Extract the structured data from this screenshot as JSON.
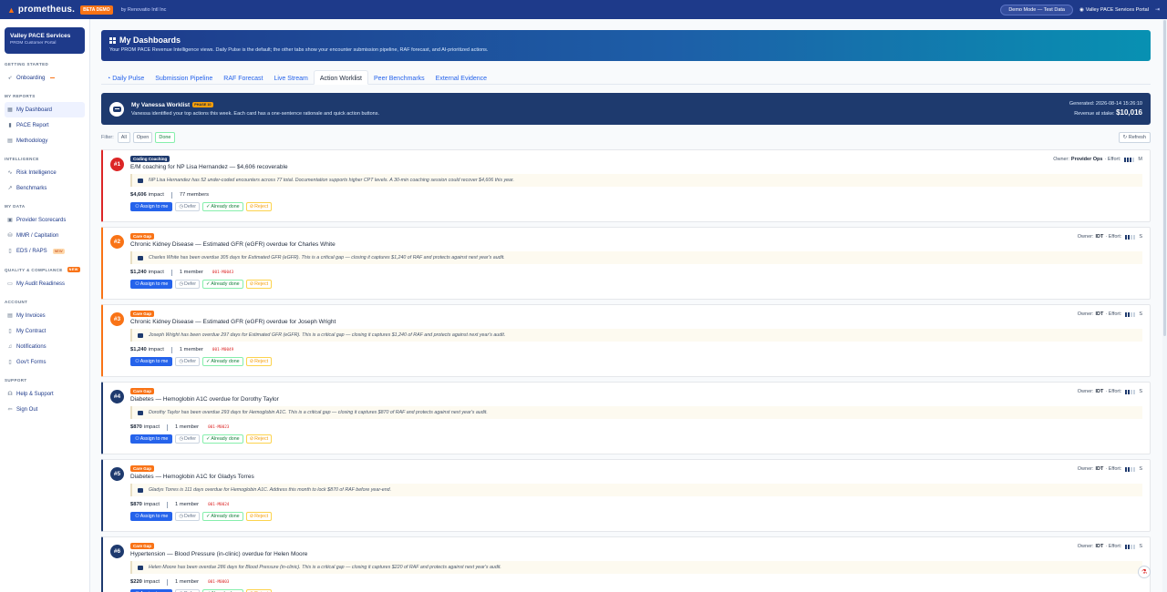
{
  "topbar": {
    "brand": "prometheus.",
    "beta": "BETA DEMO",
    "byline": "by Renovatio Intl Inc",
    "demo_mode": "Demo Mode — Test Data",
    "portal": "Valley PACE Services Portal"
  },
  "sidebar": {
    "org_name": "Valley PACE Services",
    "org_sub": "PROM Customer Portal",
    "sections": {
      "getting_started": "GETTING STARTED",
      "my_reports": "MY REPORTS",
      "intelligence": "INTELLIGENCE",
      "my_data": "MY DATA",
      "quality": "QUALITY & COMPLIANCE",
      "quality_badge": "NEW",
      "account": "ACCOUNT",
      "support": "SUPPORT"
    },
    "items": {
      "onboarding": "Onboarding",
      "my_dashboard": "My Dashboard",
      "pace_report": "PACE Report",
      "methodology": "Methodology",
      "risk_intelligence": "Risk Intelligence",
      "benchmarks": "Benchmarks",
      "provider_scorecards": "Provider Scorecards",
      "mmr_capitation": "MMR / Capitation",
      "eds_raps": "EDS / RAPS",
      "eds_badge": "NEW",
      "audit_readiness": "My Audit Readiness",
      "invoices": "My Invoices",
      "contract": "My Contract",
      "notifications": "Notifications",
      "gov_forms": "Gov't Forms",
      "help": "Help & Support",
      "sign_out": "Sign Out"
    }
  },
  "hero": {
    "title": "My Dashboards",
    "desc": "Your PROM PACE Revenue Intelligence views. Daily Pulse is the default; the other tabs show your encounter submission pipeline, RAF forecast, and AI-prioritized actions."
  },
  "tabs": [
    "Daily Pulse",
    "Submission Pipeline",
    "RAF Forecast",
    "Live Stream",
    "Action Worklist",
    "Peer Benchmarks",
    "External Evidence"
  ],
  "worklist": {
    "title": "My Vanessa Worklist",
    "phase": "PHASE 10",
    "desc": "Vanessa identified your top actions this week. Each card has a one-sentence rationale and quick action buttons.",
    "generated": "Generated: 2026-08-14 15:26:10",
    "revenue_label": "Revenue at stake:",
    "revenue": "$10,016"
  },
  "filter": {
    "label": "Filter:",
    "all": "All",
    "open": "Open",
    "done": "Done",
    "refresh": "Refresh"
  },
  "buttons": {
    "assign": "Assign to me",
    "defer": "Defer",
    "done": "Already done",
    "reject": "Reject",
    "impact": "impact",
    "owner_label": "Owner:",
    "effort_label": "· Effort:"
  },
  "cards": [
    {
      "rank": "#1",
      "category": "Coding Coaching",
      "title": "E/M coaching for NP Lisa Hernandez — $4,606 recoverable",
      "rationale": "NP Lisa Hernandez has 52 under-coded encounters across 77 total. Documentation supports higher CPT levels. A 30-min coaching session could recover $4,606 this year.",
      "impact": "$4,606",
      "members": "77 members",
      "code": "",
      "owner": "Provider Ops",
      "effort_level": 3,
      "effort_size": "M"
    },
    {
      "rank": "#2",
      "category": "Care Gap",
      "title": "Chronic Kidney Disease — Estimated GFR (eGFR) overdue for Charles White",
      "rationale": "Charles White has been overdue 305 days for Estimated GFR (eGFR). This is a critical gap — closing it captures $1,240 of RAF and protects against next year's audit.",
      "impact": "$1,240",
      "members": "1 member",
      "code": "001-M0043",
      "owner": "IDT",
      "effort_level": 2,
      "effort_size": "S"
    },
    {
      "rank": "#3",
      "category": "Care Gap",
      "title": "Chronic Kidney Disease — Estimated GFR (eGFR) overdue for Joseph Wright",
      "rationale": "Joseph Wright has been overdue 297 days for Estimated GFR (eGFR). This is a critical gap — closing it captures $1,240 of RAF and protects against next year's audit.",
      "impact": "$1,240",
      "members": "1 member",
      "code": "001-M0049",
      "owner": "IDT",
      "effort_level": 2,
      "effort_size": "S"
    },
    {
      "rank": "#4",
      "category": "Care Gap",
      "title": "Diabetes — Hemoglobin A1C overdue for Dorothy Taylor",
      "rationale": "Dorothy Taylor has been overdue 293 days for Hemoglobin A1C. This is a critical gap — closing it captures $870 of RAF and protects against next year's audit.",
      "impact": "$870",
      "members": "1 member",
      "code": "001-M0023",
      "owner": "IDT",
      "effort_level": 2,
      "effort_size": "S"
    },
    {
      "rank": "#5",
      "category": "Care Gap",
      "title": "Diabetes — Hemoglobin A1C for Gladys Torres",
      "rationale": "Gladys Torres is 111 days overdue for Hemoglobin A1C. Address this month to lock $870 of RAF before year-end.",
      "impact": "$870",
      "members": "1 member",
      "code": "001-M0024",
      "owner": "IDT",
      "effort_level": 2,
      "effort_size": "S"
    },
    {
      "rank": "#6",
      "category": "Care Gap",
      "title": "Hypertension — Blood Pressure (in-clinic) overdue for Helen Moore",
      "rationale": "Helen Moore has been overdue 286 days for Blood Pressure (in-clinic). This is a critical gap — closing it captures $220 of RAF and protects against next year's audit.",
      "impact": "$220",
      "members": "1 member",
      "code": "001-M0003",
      "owner": "IDT",
      "effort_level": 2,
      "effort_size": "S"
    }
  ]
}
